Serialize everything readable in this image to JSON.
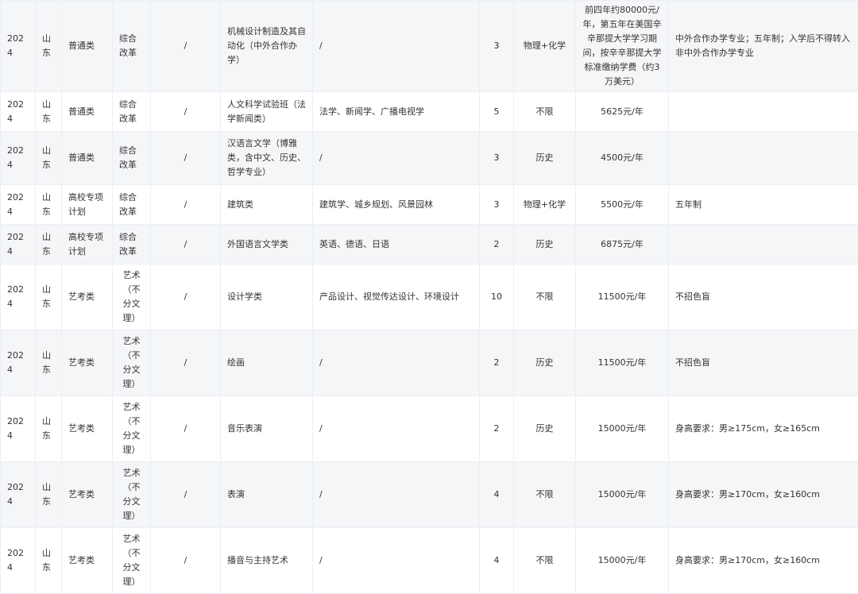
{
  "rows": [
    {
      "year": "2024",
      "province": "山东",
      "category": "普通类",
      "batch": "综合改革",
      "subject_group": "/",
      "major": "机械设计制造及其自动化（中外合作办学）",
      "includes": "/",
      "plan": "3",
      "requirement": "物理+化学",
      "tuition": "前四年约80000元/年，第五年在美国辛辛那提大学学习期间，按辛辛那提大学标准缴纳学费（约3万美元）",
      "note": "中外合作办学专业；五年制；入学后不得转入非中外合作办学专业"
    },
    {
      "year": "2024",
      "province": "山东",
      "category": "普通类",
      "batch": "综合改革",
      "subject_group": "/",
      "major": "人文科学试验班（法学新闻类）",
      "includes": "法学、新闻学、广播电视学",
      "plan": "5",
      "requirement": "不限",
      "tuition": "5625元/年",
      "note": ""
    },
    {
      "year": "2024",
      "province": "山东",
      "category": "普通类",
      "batch": "综合改革",
      "subject_group": "/",
      "major": "汉语言文学（博雅类，含中文、历史、哲学专业）",
      "includes": "/",
      "plan": "3",
      "requirement": "历史",
      "tuition": "4500元/年",
      "note": ""
    },
    {
      "year": "2024",
      "province": "山东",
      "category": "高校专项计划",
      "batch": "综合改革",
      "subject_group": "/",
      "major": "建筑类",
      "includes": "建筑学、城乡规划、风景园林",
      "plan": "3",
      "requirement": "物理+化学",
      "tuition": "5500元/年",
      "note": "五年制"
    },
    {
      "year": "2024",
      "province": "山东",
      "category": "高校专项计划",
      "batch": "综合改革",
      "subject_group": "/",
      "major": "外国语言文学类",
      "includes": "英语、德语、日语",
      "plan": "2",
      "requirement": "历史",
      "tuition": "6875元/年",
      "note": ""
    },
    {
      "year": "2024",
      "province": "山东",
      "category": "艺考类",
      "batch": "艺术（不分文理）",
      "subject_group": "/",
      "major": "设计学类",
      "includes": "产品设计、视觉传达设计、环境设计",
      "plan": "10",
      "requirement": "不限",
      "tuition": "11500元/年",
      "note": "不招色盲"
    },
    {
      "year": "2024",
      "province": "山东",
      "category": "艺考类",
      "batch": "艺术（不分文理）",
      "subject_group": "/",
      "major": "绘画",
      "includes": "/",
      "plan": "2",
      "requirement": "历史",
      "tuition": "11500元/年",
      "note": "不招色盲"
    },
    {
      "year": "2024",
      "province": "山东",
      "category": "艺考类",
      "batch": "艺术（不分文理）",
      "subject_group": "/",
      "major": "音乐表演",
      "includes": "/",
      "plan": "2",
      "requirement": "历史",
      "tuition": "15000元/年",
      "note": "身高要求：男≥175cm，女≥165cm"
    },
    {
      "year": "2024",
      "province": "山东",
      "category": "艺考类",
      "batch": "艺术（不分文理）",
      "subject_group": "/",
      "major": "表演",
      "includes": "/",
      "plan": "4",
      "requirement": "不限",
      "tuition": "15000元/年",
      "note": "身高要求：男≥170cm，女≥160cm"
    },
    {
      "year": "2024",
      "province": "山东",
      "category": "艺考类",
      "batch": "艺术（不分文理）",
      "subject_group": "/",
      "major": "播音与主持艺术",
      "includes": "/",
      "plan": "4",
      "requirement": "不限",
      "tuition": "15000元/年",
      "note": "身高要求：男≥170cm，女≥160cm"
    }
  ]
}
